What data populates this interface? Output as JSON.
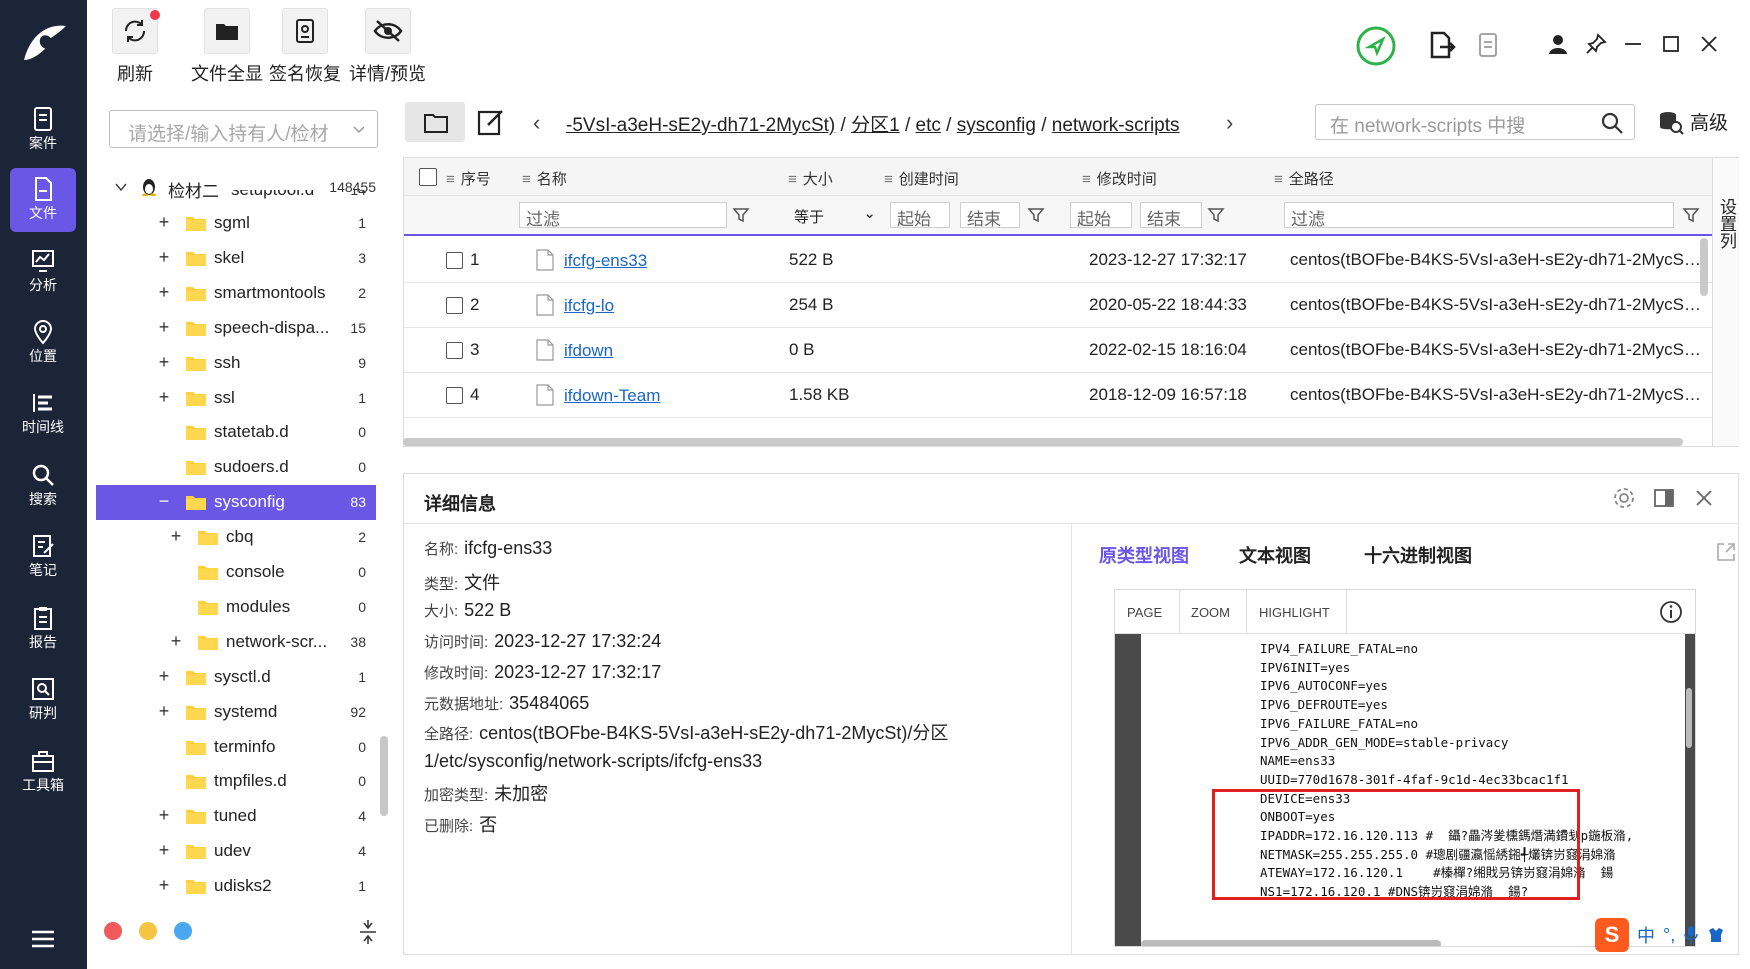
{
  "toolbar": {
    "refresh": "刷新",
    "full_files": "文件全显",
    "signature_restore": "签名恢复",
    "details_preview": "详情/预览"
  },
  "nav": {
    "cases": "案件",
    "files": "文件",
    "analysis": "分析",
    "location": "位置",
    "timeline": "时间线",
    "search": "搜索",
    "notes": "笔记",
    "report": "报告",
    "judge": "研判",
    "toolbox": "工具箱"
  },
  "tree": {
    "select_placeholder": "请选择/输入持有人/检材",
    "root_name": "检材二",
    "root_count": "148455",
    "partial_name": "setuptool.d",
    "partial_count": "14",
    "items": [
      {
        "name": "sgml",
        "count": "1"
      },
      {
        "name": "skel",
        "count": "3"
      },
      {
        "name": "smartmontools",
        "count": "2"
      },
      {
        "name": "speech-dispa...",
        "count": "15"
      },
      {
        "name": "ssh",
        "count": "9"
      },
      {
        "name": "ssl",
        "count": "1"
      },
      {
        "name": "statetab.d",
        "count": "0"
      },
      {
        "name": "sudoers.d",
        "count": "0"
      },
      {
        "name": "sysconfig",
        "count": "83"
      },
      {
        "name": "cbq",
        "count": "2"
      },
      {
        "name": "console",
        "count": "0"
      },
      {
        "name": "modules",
        "count": "0"
      },
      {
        "name": "network-scr...",
        "count": "38"
      },
      {
        "name": "sysctl.d",
        "count": "1"
      },
      {
        "name": "systemd",
        "count": "92"
      },
      {
        "name": "terminfo",
        "count": "0"
      },
      {
        "name": "tmpfiles.d",
        "count": "0"
      },
      {
        "name": "tuned",
        "count": "4"
      },
      {
        "name": "udev",
        "count": "4"
      },
      {
        "name": "udisks2",
        "count": "1"
      }
    ]
  },
  "path": {
    "crumb_partial": "-5VsI-a3eH-sE2y-dh71-2MycSt)",
    "crumb_part": "分区1",
    "crumb_etc": "etc",
    "crumb_sysconfig": "sysconfig",
    "crumb_network": "network-scripts",
    "sep": "/",
    "search_placeholder": "在 network-scripts 中搜",
    "advanced": "高级"
  },
  "table": {
    "headers": {
      "index": "序号",
      "name": "名称",
      "size": "大小",
      "ctime": "创建时间",
      "mtime": "修改时间",
      "fullpath": "全路径"
    },
    "filter": {
      "filter": "过滤",
      "equals": "等于",
      "start": "起始",
      "end": "结束"
    },
    "settings_col": "设置列",
    "rows": [
      {
        "idx": "1",
        "name": "ifcfg-ens33",
        "size": "522 B",
        "mtime": "2023-12-27 17:32:17",
        "path": "centos(tBOFbe-B4KS-5VsI-a3eH-sE2y-dh71-2MycSt)..."
      },
      {
        "idx": "2",
        "name": "ifcfg-lo",
        "size": "254 B",
        "mtime": "2020-05-22 18:44:33",
        "path": "centos(tBOFbe-B4KS-5VsI-a3eH-sE2y-dh71-2MycSt)..."
      },
      {
        "idx": "3",
        "name": "ifdown",
        "size": "0 B",
        "mtime": "2022-02-15 18:16:04",
        "path": "centos(tBOFbe-B4KS-5VsI-a3eH-sE2y-dh71-2MycSt)..."
      },
      {
        "idx": "4",
        "name": "ifdown-Team",
        "size": "1.58 KB",
        "mtime": "2018-12-09 16:57:18",
        "path": "centos(tBOFbe-B4KS-5VsI-a3eH-sE2y-dh71-2MycSt)..."
      }
    ]
  },
  "detail": {
    "title": "详细信息",
    "name_label": "名称:",
    "name_value": "ifcfg-ens33",
    "type_label": "类型:",
    "type_value": "文件",
    "size_label": "大小:",
    "size_value": "522 B",
    "atime_label": "访问时间:",
    "atime_value": "2023-12-27 17:32:24",
    "mtime_label": "修改时间:",
    "mtime_value": "2023-12-27 17:32:17",
    "meta_label": "元数据地址:",
    "meta_value": "35484065",
    "path_label": "全路径:",
    "path_value": "centos(tBOFbe-B4KS-5VsI-a3eH-sE2y-dh71-2MycSt)/分区1/etc/sysconfig/network-scripts/ifcfg-ens33",
    "enc_label": "加密类型:",
    "enc_value": "未加密",
    "del_label": "已删除:",
    "del_value": "否"
  },
  "viewer": {
    "tab_native": "原类型视图",
    "tab_text": "文本视图",
    "tab_hex": "十六进制视图",
    "page": "PAGE",
    "zoom": "ZOOM",
    "highlight": "HIGHLIGHT",
    "code": "IPV4_FAILURE_FATAL=no\nIPV6INIT=yes\nIPV6_AUTOCONF=yes\nIPV6_DEFROUTE=yes\nIPV6_FAILURE_FATAL=no\nIPV6_ADDR_GEN_MODE=stable-privacy\nNAME=ens33\nUUID=770d1678-301f-4faf-9c1d-4ec33bcac1f1\nDEVICE=ens33\nONBOOT=yes\nIPADDR=172.16.120.113 #  鑷?畾涔夎櫄鎷熸満鐨刬p鍦板潃,\nNETMASK=255.255.255.0 #璁剧疆瀛愮綉鎺╃爜锛岃窡涓婂潃\nATEWAY=172.16.120.1    #榛樿?缃戝叧锛岃窡涓婂潃  鍚\nNS1=172.16.120.1 #DNS锛岃窡涓婂潃  鍚?"
  },
  "ime": {
    "lang": "中"
  }
}
